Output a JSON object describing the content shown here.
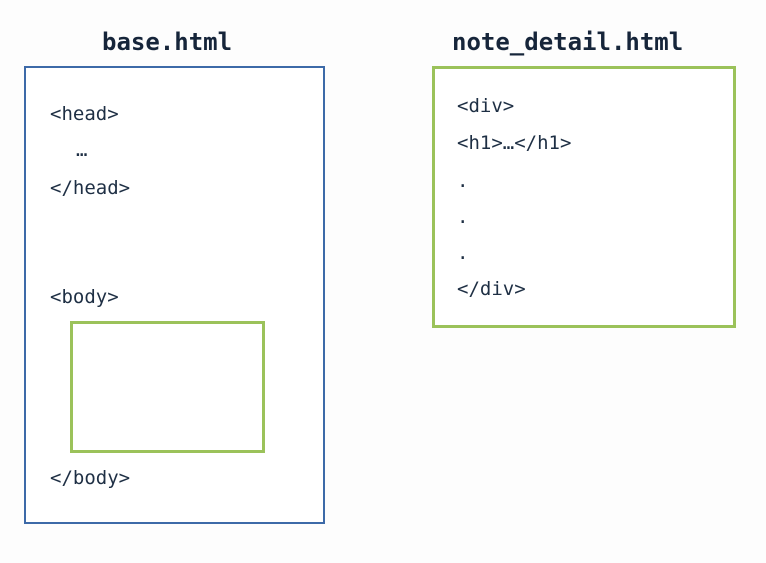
{
  "base": {
    "title": "base.html",
    "lines": {
      "head_open": "<head>",
      "ellipsis": "…",
      "head_close": "</head>",
      "body_open": "<body>",
      "body_close": "</body>"
    }
  },
  "detail": {
    "title": "note_detail.html",
    "lines": {
      "div_open": "<div>",
      "h1": "<h1>…</h1>",
      "dot1": ".",
      "dot2": ".",
      "dot3": ".",
      "div_close": "</div>"
    }
  },
  "colors": {
    "base_border": "#3d6aa8",
    "green_border": "#9bc25a",
    "text": "#1e2f44"
  }
}
